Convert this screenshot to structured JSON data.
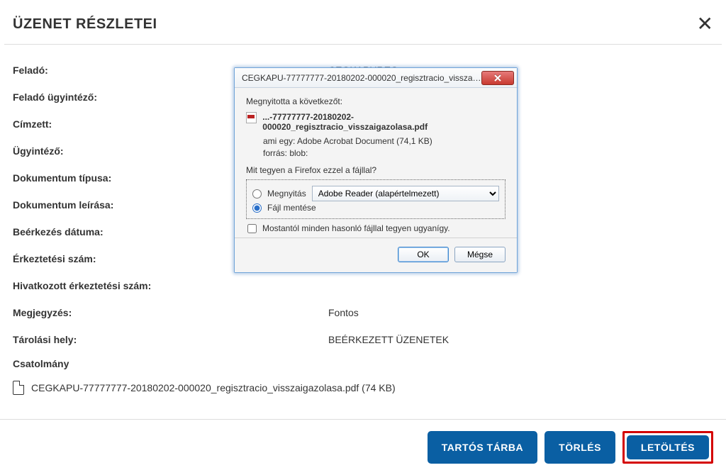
{
  "header": {
    "title": "ÜZENET RÉSZLETEI"
  },
  "fields": {
    "sender_label": "Feladó:",
    "sender_value": "CEGKAPUREG",
    "sender_admin_label": "Feladó ügyintéző:",
    "recipient_label": "Címzett:",
    "admin_label": "Ügyintéző:",
    "doctype_label": "Dokumentum típusa:",
    "docdesc_label": "Dokumentum leírása:",
    "received_label": "Beérkezés dátuma:",
    "arrivalno_label": "Érkeztetési szám:",
    "ref_arrivalno_label": "Hivatkozott érkeztetési szám:",
    "note_label": "Megjegyzés:",
    "note_value": "Fontos",
    "storage_label": "Tárolási hely:",
    "storage_value": "BEÉRKEZETT ÜZENETEK"
  },
  "attachment": {
    "section_label": "Csatolmány",
    "file_name": "CEGKAPU-77777777-20180202-000020_regisztracio_visszaigazolasa.pdf (74 KB)"
  },
  "footer": {
    "btn_store": "TARTÓS TÁRBA",
    "btn_delete": "TÖRLÉS",
    "btn_download": "LETÖLTÉS"
  },
  "dialog": {
    "title": "CEGKAPU-77777777-20180202-000020_regisztracio_visszaigazolasa.p...",
    "opened_label": "Megnyitotta a következőt:",
    "file_display": "...-77777777-20180202-000020_regisztracio_visszaigazolasa.pdf",
    "which_is": "ami egy:  Adobe Acrobat Document (74,1 KB)",
    "source": "forrás:  blob:",
    "question": "Mit tegyen a Firefox ezzel a fájllal?",
    "open_label": "Megnyitás",
    "open_app": "Adobe Reader  (alapértelmezett)",
    "save_label": "Fájl mentése",
    "remember_label": "Mostantól minden hasonló fájllal tegyen ugyanígy.",
    "ok": "OK",
    "cancel": "Mégse"
  }
}
